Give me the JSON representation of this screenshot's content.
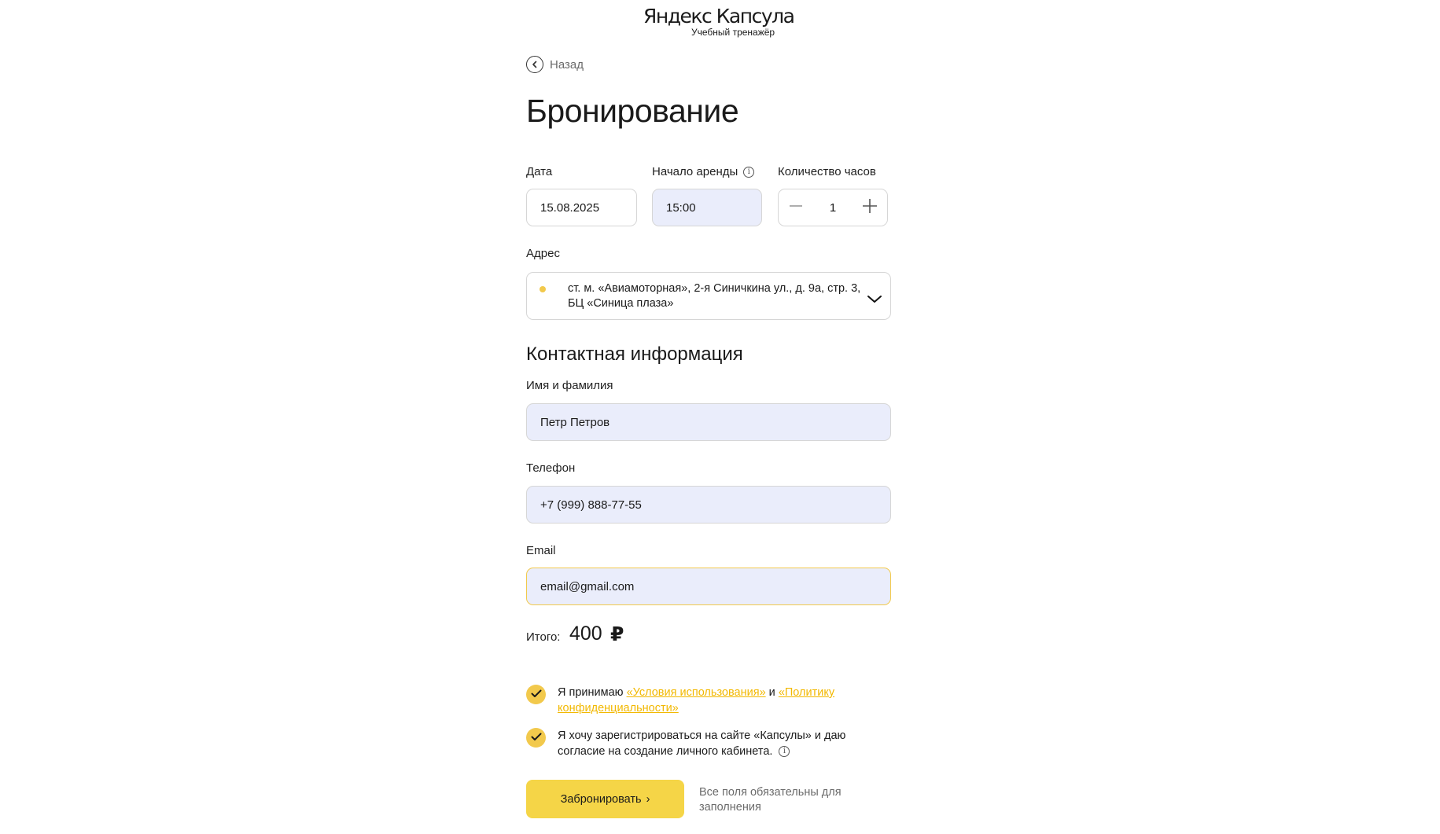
{
  "logo": {
    "brand": "Яндекс Капсула",
    "subtitle": "Учебный тренажёр"
  },
  "back": {
    "label": "Назад"
  },
  "page_title": "Бронирование",
  "booking": {
    "date_label": "Дата",
    "date_value": "15.08.2025",
    "start_label": "Начало аренды",
    "start_value": "15:00",
    "hours_label": "Количество часов",
    "hours_value": "1"
  },
  "address": {
    "label": "Адрес",
    "value": "ст. м. «Авиамоторная», 2-я Синичкина ул., д. 9а, стр. 3, БЦ «Синица плаза»"
  },
  "contact": {
    "section_title": "Контактная информация",
    "name_label": "Имя и фамилия",
    "name_value": "Петр Петров",
    "phone_label": "Телефон",
    "phone_value": "+7 (999) 888-77-55",
    "email_label": "Email",
    "email_value": "email@gmail.com"
  },
  "total": {
    "label": "Итого:",
    "value": "400",
    "currency": "₽"
  },
  "consents": {
    "terms_prefix": "Я принимаю ",
    "terms_link": "«Условия использования»",
    "terms_and": " и ",
    "privacy_link": "«Политику конфиденциальности»",
    "register_text": "Я хочу зарегистрироваться на сайте «Капсулы» и даю согласие на создание личного кабинета."
  },
  "submit": {
    "label": "Забронировать",
    "arrow": "›"
  },
  "required_note": "Все поля обязательны для заполнения",
  "colors": {
    "accent": "#f5d547",
    "filled_field": "#eaedfb",
    "link": "#f2b800"
  }
}
